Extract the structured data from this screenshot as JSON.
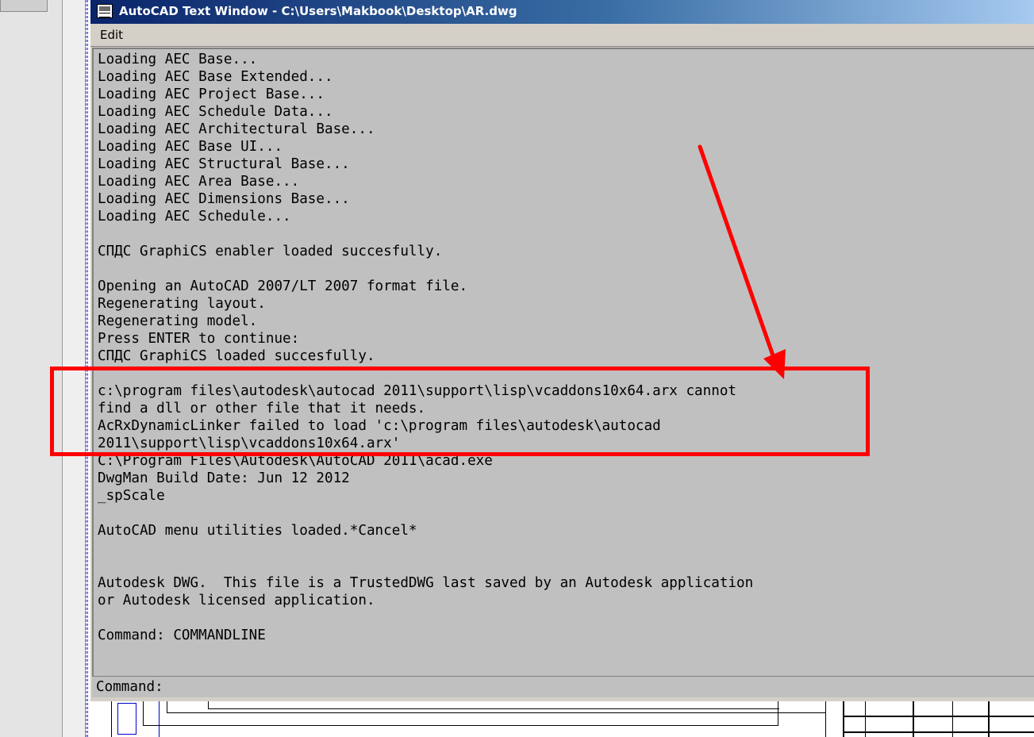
{
  "window": {
    "title": "AutoCAD Text Window - C:\\Users\\Makbook\\Desktop\\AR.dwg",
    "menu": [
      {
        "label": "Edit"
      }
    ]
  },
  "log_lines": [
    "Loading AEC Base...",
    "Loading AEC Base Extended...",
    "Loading AEC Project Base...",
    "Loading AEC Schedule Data...",
    "Loading AEC Architectural Base...",
    "Loading AEC Base UI...",
    "Loading AEC Structural Base...",
    "Loading AEC Area Base...",
    "Loading AEC Dimensions Base...",
    "Loading AEC Schedule...",
    "",
    "СПДС GraphiCS enabler loaded succesfully.",
    "",
    "Opening an AutoCAD 2007/LT 2007 format file.",
    "Regenerating layout.",
    "Regenerating model.",
    "Press ENTER to continue:",
    "СПДС GraphiCS loaded succesfully.",
    "",
    "c:\\program files\\autodesk\\autocad 2011\\support\\lisp\\vcaddons10x64.arx cannot",
    "find a dll or other file that it needs.",
    "AcRxDynamicLinker failed to load 'c:\\program files\\autodesk\\autocad",
    "2011\\support\\lisp\\vcaddons10x64.arx'",
    "C:\\Program Files\\Autodesk\\AutoCAD 2011\\acad.exe",
    "DwgMan Build Date: Jun 12 2012",
    "_spScale",
    "",
    "AutoCAD menu utilities loaded.*Cancel*",
    "",
    "",
    "Autodesk DWG.  This file is a TrustedDWG last saved by an Autodesk application",
    "or Autodesk licensed application.",
    "",
    "Command: COMMANDLINE"
  ],
  "command_line": {
    "label": "Command:",
    "value": ""
  },
  "annotations": {
    "color": "#ff0000"
  },
  "colors": {
    "titlebar_start": "#0a246a",
    "titlebar_end": "#a6caf0",
    "text_background": "#c0c0c0"
  }
}
